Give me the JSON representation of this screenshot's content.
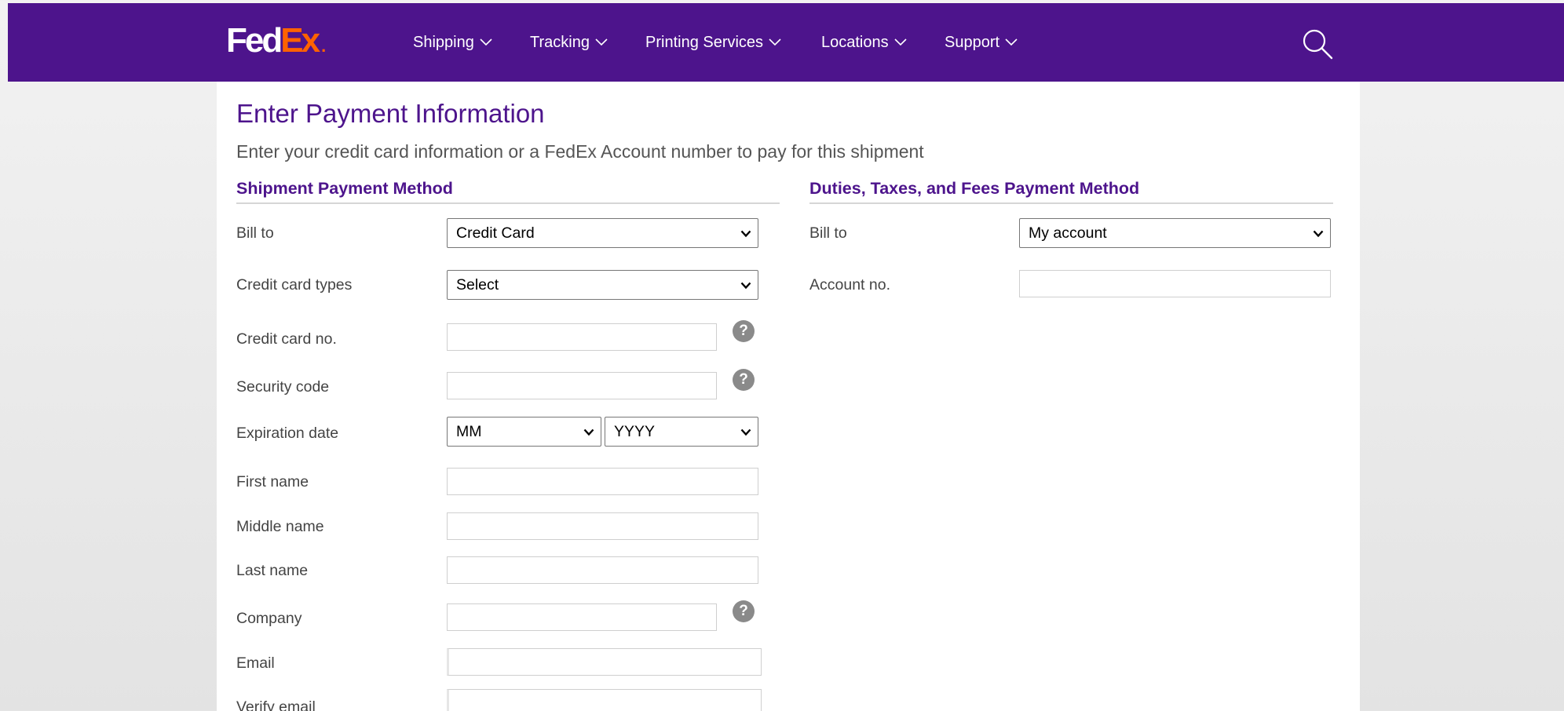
{
  "header": {
    "logo_fed": "Fed",
    "logo_ex": "Ex",
    "logo_dot": ".",
    "nav": [
      {
        "label": "Shipping"
      },
      {
        "label": "Tracking"
      },
      {
        "label": "Printing Services"
      },
      {
        "label": "Locations"
      },
      {
        "label": "Support"
      }
    ],
    "search_icon": "search-icon",
    "brand_purple": "#4d148c",
    "brand_orange": "#ff6200"
  },
  "page": {
    "title": "Enter Payment Information",
    "subtitle": "Enter your credit card information or a FedEx Account number to pay for this shipment"
  },
  "shipment_payment": {
    "heading": "Shipment Payment Method",
    "bill_to_label": "Bill to",
    "bill_to_value": "Credit Card",
    "card_types_label": "Credit card types",
    "card_types_value": "Select",
    "card_no_label": "Credit card no.",
    "card_no_value": "",
    "security_code_label": "Security code",
    "security_code_value": "",
    "expiration_label": "Expiration date",
    "exp_month_value": "MM",
    "exp_year_value": "YYYY",
    "first_name_label": "First name",
    "middle_name_label": "Middle name",
    "last_name_label": "Last name",
    "company_label": "Company",
    "email_label": "Email",
    "verify_email_label": "Verify email",
    "help_glyph": "?"
  },
  "duties_payment": {
    "heading": "Duties, Taxes, and Fees Payment Method",
    "bill_to_label": "Bill to",
    "bill_to_value": "My account",
    "account_no_label": "Account no.",
    "account_no_value": ""
  }
}
